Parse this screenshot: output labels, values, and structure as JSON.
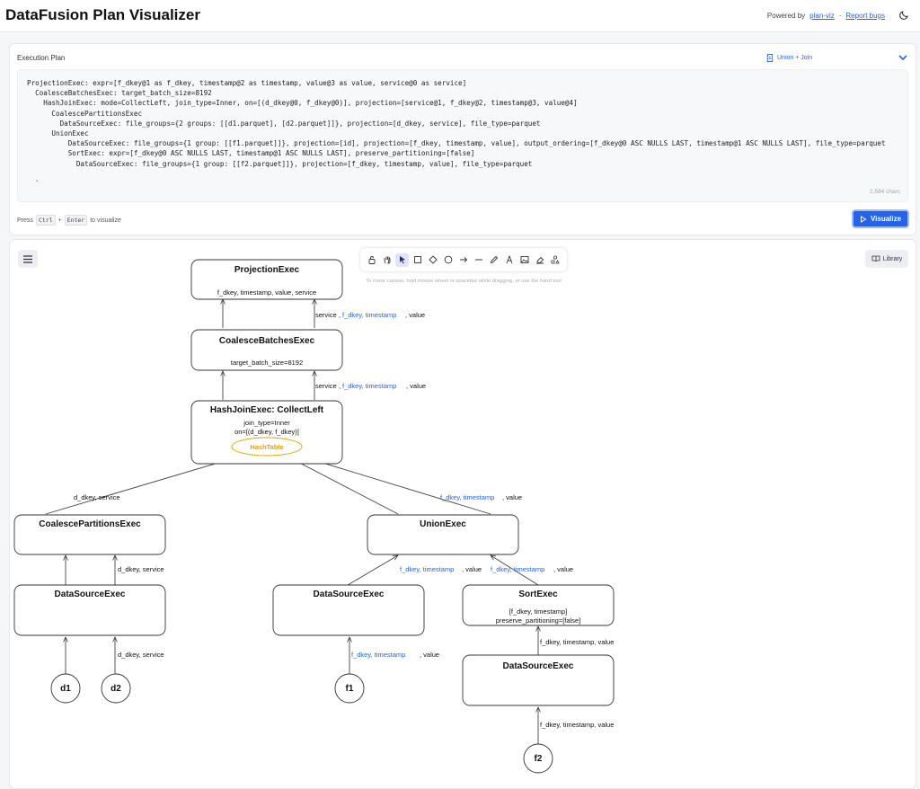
{
  "header": {
    "title": "DataFusion Plan Visualizer",
    "powered_by": "Powered by",
    "powered_link": "plan-viz",
    "separator": "·",
    "report_bugs": "Report bugs"
  },
  "plan_panel": {
    "label": "Execution Plan",
    "preset": "Union + Join",
    "code": "ProjectionExec: expr=[f_dkey@1 as f_dkey, timestamp@2 as timestamp, value@3 as value, service@0 as service]\n  CoalesceBatchesExec: target_batch_size=8192\n    HashJoinExec: mode=CollectLeft, join_type=Inner, on=[(d_dkey@0, f_dkey@0)], projection=[service@1, f_dkey@2, timestamp@3, value@4]\n      CoalescePartitionsExec\n        DataSourceExec: file_groups={2 groups: [[d1.parquet], [d2.parquet]]}, projection=[d_dkey, service], file_type=parquet\n      UnionExec\n          DataSourceExec: file_groups={1 group: [[f1.parquet]]}, projection=[id], projection=[f_dkey, timestamp, value], output_ordering=[f_dkey@0 ASC NULLS LAST, timestamp@1 ASC NULLS LAST], file_type=parquet\n          SortExec: expr=[f_dkey@0 ASC NULLS LAST, timestamp@1 ASC NULLS LAST], preserve_partitioning=[false]\n            DataSourceExec: file_groups={1 group: [[f2.parquet]]}, projection=[f_dkey, timestamp, value], file_type=parquet\n\n  `",
    "char_count": "2,584 chars",
    "hint_press": "Press",
    "hint_key1": "Ctrl",
    "hint_plus": "+",
    "hint_key2": "Enter",
    "hint_suffix": "to visualize",
    "visualize_label": "Visualize"
  },
  "canvas": {
    "library_label": "Library",
    "tool_hint": "To move canvas, hold mouse wheel or spacebar while dragging, or use the hand tool",
    "tools": [
      "lock-icon",
      "hand-icon",
      "pointer-icon",
      "rectangle-icon",
      "diamond-icon",
      "ellipse-icon",
      "arrow-icon",
      "line-icon",
      "pencil-icon",
      "text-icon",
      "image-icon",
      "eraser-icon",
      "shapes-icon"
    ],
    "nodes": {
      "projection": {
        "title": "ProjectionExec",
        "detail": "f_dkey, timestamp, value, service"
      },
      "coalesce_batches": {
        "title": "CoalesceBatchesExec",
        "detail": "target_batch_size=8192"
      },
      "hash_join": {
        "title": "HashJoinExec: CollectLeft",
        "detail1": "join_type=Inner",
        "detail2": "on=[(d_dkey, f_dkey)]",
        "hash_table": "HashTable"
      },
      "coalesce_partitions": {
        "title": "CoalescePartitionsExec"
      },
      "union": {
        "title": "UnionExec"
      },
      "ds_left": {
        "title": "DataSourceExec"
      },
      "ds_mid": {
        "title": "DataSourceExec"
      },
      "sort": {
        "title": "SortExec",
        "detail1": "[f_dkey, timestamp]",
        "detail2": "preserve_partitioning=[false]"
      },
      "ds_f2": {
        "title": "DataSourceExec"
      },
      "d1": "d1",
      "d2": "d2",
      "f1": "f1",
      "f2": "f2"
    },
    "edge_labels": {
      "service": "service",
      "comma": ",",
      "f_dkey_timestamp": "f_dkey, timestamp",
      "value": ", value",
      "d_dkey_service": "d_dkey, service",
      "f_dkey_timestamp_value": "f_dkey, timestamp, value"
    },
    "colors": {
      "accent": "#2563eb",
      "hash_table": "#e5a400",
      "link": "#2563eb"
    }
  }
}
